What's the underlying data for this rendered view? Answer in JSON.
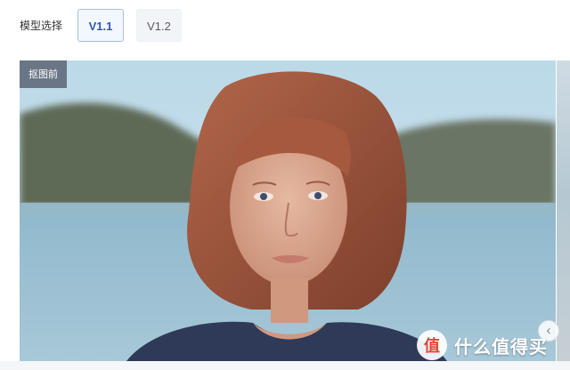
{
  "model_select": {
    "label": "模型选择",
    "options": [
      {
        "label": "V1.1",
        "selected": true
      },
      {
        "label": "V1.2",
        "selected": false
      }
    ]
  },
  "preview": {
    "tag": "抠图前"
  },
  "watermark": {
    "logo_glyph": "值",
    "text": "什么值得买"
  },
  "controls": {
    "next_arrow": "‹"
  },
  "colors": {
    "selected_border": "#a9bfe6",
    "selected_text": "#2f5bab",
    "unselected_bg": "#f2f4f7",
    "tag_bg": "#5f6876"
  }
}
